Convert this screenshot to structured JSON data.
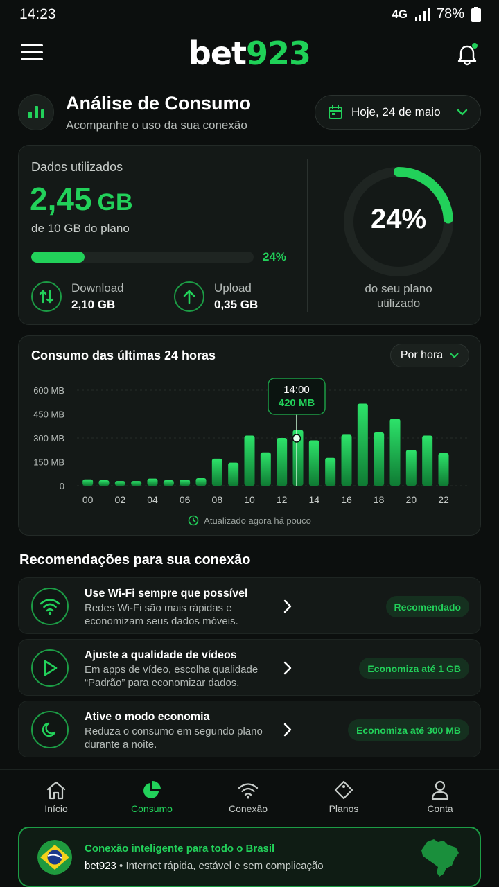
{
  "status": {
    "time": "14:23",
    "network": "4G",
    "battery": "78%"
  },
  "header": {
    "logo_part1": "bet",
    "logo_part2": "923"
  },
  "title": {
    "heading": "Análise de Consumo",
    "subtitle": "Acompanhe o uso da sua conexão",
    "date_label": "Hoje, 24 de maio"
  },
  "usage": {
    "label": "Dados utilizados",
    "value": "2,45",
    "unit": "GB",
    "plan_text": "de 10 GB do plano",
    "percent_text": "24%",
    "percent": 0.24,
    "download_label": "Download",
    "download_value": "2,10 GB",
    "upload_label": "Upload",
    "upload_value": "0,35 GB",
    "ring_percent": "24%",
    "ring_caption_1": "do seu plano",
    "ring_caption_2": "utilizado"
  },
  "chart_section": {
    "title": "Consumo das últimas 24 horas",
    "period": "Por hora",
    "updated": "Atualizado agora há pouco"
  },
  "chart_data": {
    "type": "bar",
    "ylim": [
      0,
      600
    ],
    "yticks": [
      "600 MB",
      "450 MB",
      "300 MB",
      "150 MB",
      "0"
    ],
    "ytick_values": [
      600,
      450,
      300,
      150,
      0
    ],
    "xtick_labels": [
      "00",
      "02",
      "04",
      "06",
      "08",
      "10",
      "12",
      "14",
      "16",
      "18",
      "20",
      "22"
    ],
    "hours": [
      0,
      1,
      2,
      3,
      4,
      5,
      6,
      7,
      8,
      9,
      10,
      11,
      12,
      13,
      14,
      15,
      16,
      17,
      18,
      19,
      20,
      21,
      22,
      23
    ],
    "values": [
      40,
      35,
      30,
      30,
      45,
      35,
      38,
      48,
      170,
      145,
      315,
      210,
      300,
      350,
      285,
      175,
      320,
      515,
      335,
      420,
      225,
      315,
      205,
      0
    ],
    "tooltip": {
      "hour_index": 13,
      "time": "14:00",
      "value": "420 MB"
    }
  },
  "recommendations": {
    "heading": "Recomendações para sua conexão",
    "items": [
      {
        "icon": "wifi-icon",
        "title": "Use Wi-Fi sempre que possível",
        "desc_1": "Redes Wi-Fi são mais rápidas e",
        "desc_2": "economizam seus dados móveis.",
        "badge": "Recomendado"
      },
      {
        "icon": "play-icon",
        "title": "Ajuste a qualidade de vídeos",
        "desc_1": "Em apps de vídeo, escolha qualidade",
        "desc_2": "“Padrão” para economizar dados.",
        "badge": "Economiza até 1 GB"
      },
      {
        "icon": "moon-icon",
        "title": "Ative o modo economia",
        "desc_1": "Reduza o consumo em segundo plano",
        "desc_2": "durante a noite.",
        "badge": "Economiza até 300 MB"
      }
    ]
  },
  "nav": {
    "home": "Início",
    "usage": "Consumo",
    "connection": "Conexão",
    "plans": "Planos",
    "account": "Conta"
  },
  "banner": {
    "title": "Conexão inteligente para todo o Brasil",
    "brand": "bet923",
    "text": " • Internet rápida, estável e sem complicação"
  },
  "colors": {
    "accent": "#22d15a",
    "background": "#0c0f0e",
    "card": "#141917"
  }
}
